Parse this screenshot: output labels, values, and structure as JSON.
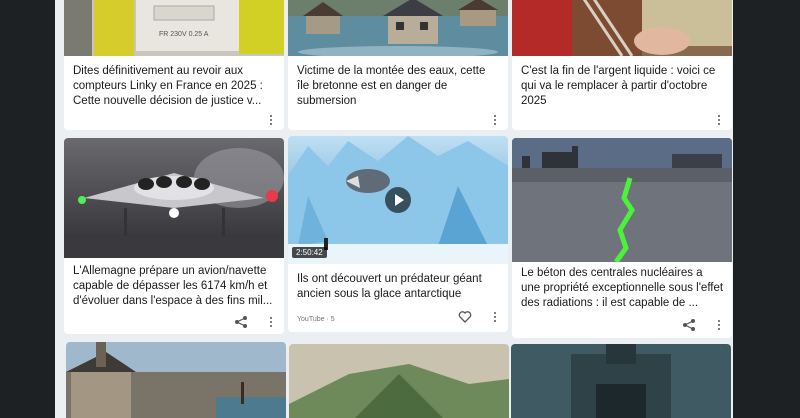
{
  "cards": [
    {
      "title": "Dites définitivement au revoir aux compteurs Linky en France en 2025 : Cette nouvelle décision de justice v...",
      "image": "linky-meter-image"
    },
    {
      "title": "Victime de la montée des eaux, cette île bretonne est en danger de submersion",
      "image": "flooded-houses-image"
    },
    {
      "title": "C'est la fin de l'argent liquide : voici ce qui va le remplacer à partir d'octobre 2025",
      "image": "cash-wallet-image"
    },
    {
      "title": "L'Allemagne prépare un avion/navette capable de dépasser les 6174 km/h et d'évoluer dans l'espace à des fins mil...",
      "image": "spaceplane-image"
    },
    {
      "title": "Ils ont découvert un prédateur géant ancien sous la glace antarctique",
      "image": "ice-predator-image",
      "duration": "2:50:42",
      "source": "YouTube · 5"
    },
    {
      "title": "Le béton des centrales nucléaires a une propriété exceptionnelle sous l'effet des radiations : il est capable de ...",
      "image": "cracked-concrete-image"
    },
    {
      "title": "",
      "image": "harbor-village-image"
    },
    {
      "title": "",
      "image": "mountain-landscape-image"
    },
    {
      "title": "",
      "image": "ancient-ruins-image"
    }
  ]
}
